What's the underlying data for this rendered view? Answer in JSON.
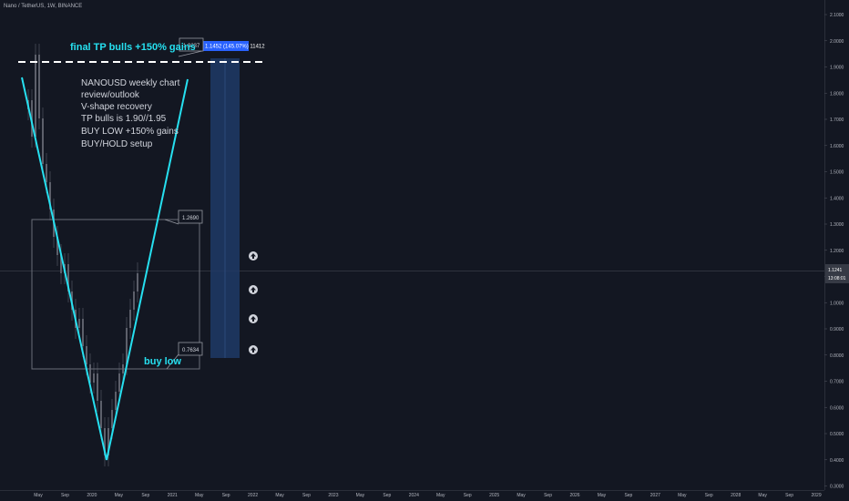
{
  "header": {
    "symbol": "Nano / TetherUS, 1W, BINANCE"
  },
  "colors": {
    "background": "#131722",
    "cyan": "#26e0f0",
    "candle": "#5d606b",
    "position": "#1e3a66",
    "position_label": "#2962ff"
  },
  "chart_data": {
    "type": "candlestick",
    "y_scale": "log",
    "ylim": [
      0.3,
      2.15
    ],
    "y_ticks": [
      "2.1000",
      "2.0000",
      "1.9000",
      "1.8000",
      "1.7000",
      "1.6000",
      "1.5000",
      "1.4000",
      "1.3000",
      "1.2000",
      "1.1000",
      "1.0000",
      "0.9000",
      "0.8000",
      "0.7000",
      "0.6000",
      "0.5000",
      "0.4000",
      "0.3000"
    ],
    "x_ticks": [
      "May",
      "Sep",
      "2020",
      "May",
      "Sep",
      "2021",
      "May",
      "Sep",
      "2022",
      "May",
      "Sep",
      "2023",
      "May",
      "Sep",
      "2024",
      "May",
      "Sep",
      "2025",
      "May",
      "Sep",
      "2026",
      "May",
      "Sep",
      "2027",
      "May",
      "Sep",
      "2028",
      "May",
      "Sep",
      "2029"
    ],
    "current_price": "1.1241",
    "countdown": "13:08:01",
    "levels": [
      {
        "label": "1.9237",
        "value": 1.9237
      },
      {
        "label": "1.2690",
        "value": 1.269
      },
      {
        "label": "0.7634",
        "value": 0.7634
      }
    ],
    "position_label": "1.1452 (145.07%) 11412",
    "annotations": {
      "target": "final TP bulls +150% gains",
      "buy": "buy low",
      "review": [
        "NANOUSD weekly chart",
        "review/outlook",
        "V-shape recovery",
        "TP bulls is 1.90//1.95",
        "BUY LOW +150% gains",
        "BUY/HOLD setup"
      ]
    },
    "arrows": [
      "up",
      "up",
      "up",
      "up"
    ]
  }
}
